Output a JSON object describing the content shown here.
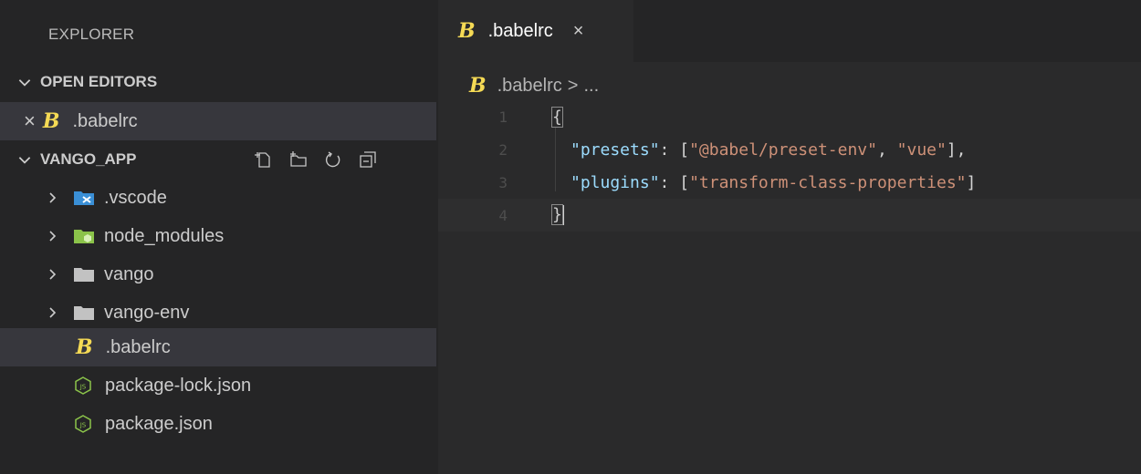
{
  "sidebar": {
    "title": "EXPLORER",
    "open_editors": {
      "header": "OPEN EDITORS",
      "items": [
        {
          "label": ".babelrc",
          "icon": "babel-icon"
        }
      ]
    },
    "workspace": {
      "header": "VANGO_APP",
      "actions": [
        "new-file-icon",
        "new-folder-icon",
        "refresh-icon",
        "collapse-all-icon"
      ],
      "items": [
        {
          "label": ".vscode",
          "type": "folder",
          "icon": "vscode-folder-icon"
        },
        {
          "label": "node_modules",
          "type": "folder",
          "icon": "node-folder-icon"
        },
        {
          "label": "vango",
          "type": "folder",
          "icon": "folder-icon"
        },
        {
          "label": "vango-env",
          "type": "folder",
          "icon": "folder-icon"
        },
        {
          "label": ".babelrc",
          "type": "file",
          "icon": "babel-icon",
          "selected": true
        },
        {
          "label": "package-lock.json",
          "type": "file",
          "icon": "json-icon"
        },
        {
          "label": "package.json",
          "type": "file",
          "icon": "json-icon"
        }
      ]
    }
  },
  "editor": {
    "tab": {
      "label": ".babelrc",
      "close": "×"
    },
    "breadcrumb": {
      "file": ".babelrc",
      "separator": ">",
      "more": "..."
    },
    "line_numbers": [
      "1",
      "2",
      "3",
      "4"
    ],
    "code": {
      "line1": "{",
      "line2": {
        "key": "\"presets\"",
        "colon": ": [",
        "v1": "\"@babel/preset-env\"",
        "comma": ", ",
        "v2": "\"vue\"",
        "end": "],"
      },
      "line3": {
        "key": "\"plugins\"",
        "colon": ": [",
        "v1": "\"transform-class-properties\"",
        "end": "]"
      },
      "line4": "}"
    }
  },
  "colors": {
    "sidebar_bg": "#252526",
    "editor_bg": "#2a2a2b",
    "babel_yellow": "#f5da55",
    "json_green": "#8bc34a",
    "key_blue": "#9cdcfe",
    "string_orange": "#ce9178"
  }
}
